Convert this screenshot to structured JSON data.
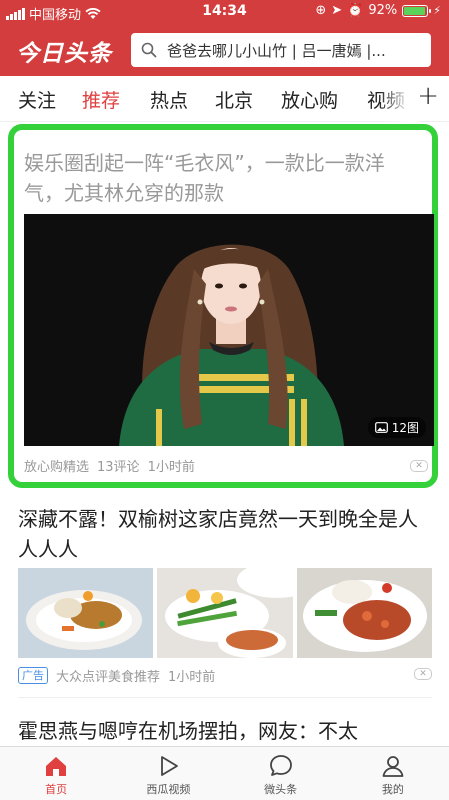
{
  "status_bar": {
    "carrier": "中国移动",
    "time": "14:34",
    "battery_percent": "92%",
    "battery_level": 0.92
  },
  "header": {
    "logo": "今日头条",
    "search_placeholder": "爸爸去哪儿小山竹 | 吕一唐嫣 |..."
  },
  "tabs": [
    {
      "label": "关注",
      "active": false
    },
    {
      "label": "推荐",
      "active": true
    },
    {
      "label": "热点",
      "active": false
    },
    {
      "label": "北京",
      "active": false
    },
    {
      "label": "放心购",
      "active": false
    },
    {
      "label": "视频",
      "active": false
    }
  ],
  "articles": [
    {
      "title": "娱乐圈刮起一阵“毛衣风”，一款比一款洋气，尤其林允穿的那款",
      "image_count": "12图",
      "source": "放心购精选",
      "comments": "13评论",
      "time": "1小时前"
    },
    {
      "title": "深藏不露！双榆树这家店竟然一天到晚全是人人人人",
      "ad_label": "广告",
      "source": "大众点评美食推荐",
      "time": "1小时前"
    },
    {
      "title": "霍思燕与嗯哼在机场摆拍，网友：不太"
    }
  ],
  "bottom_nav": [
    {
      "label": "首页",
      "icon": "home-icon",
      "active": true
    },
    {
      "label": "西瓜视频",
      "icon": "play-icon",
      "active": false
    },
    {
      "label": "微头条",
      "icon": "chat-bubble-icon",
      "active": false
    },
    {
      "label": "我的",
      "icon": "user-icon",
      "active": false
    }
  ],
  "colors": {
    "brand_red": "#d43d3d",
    "highlight_green": "#35d13b"
  }
}
